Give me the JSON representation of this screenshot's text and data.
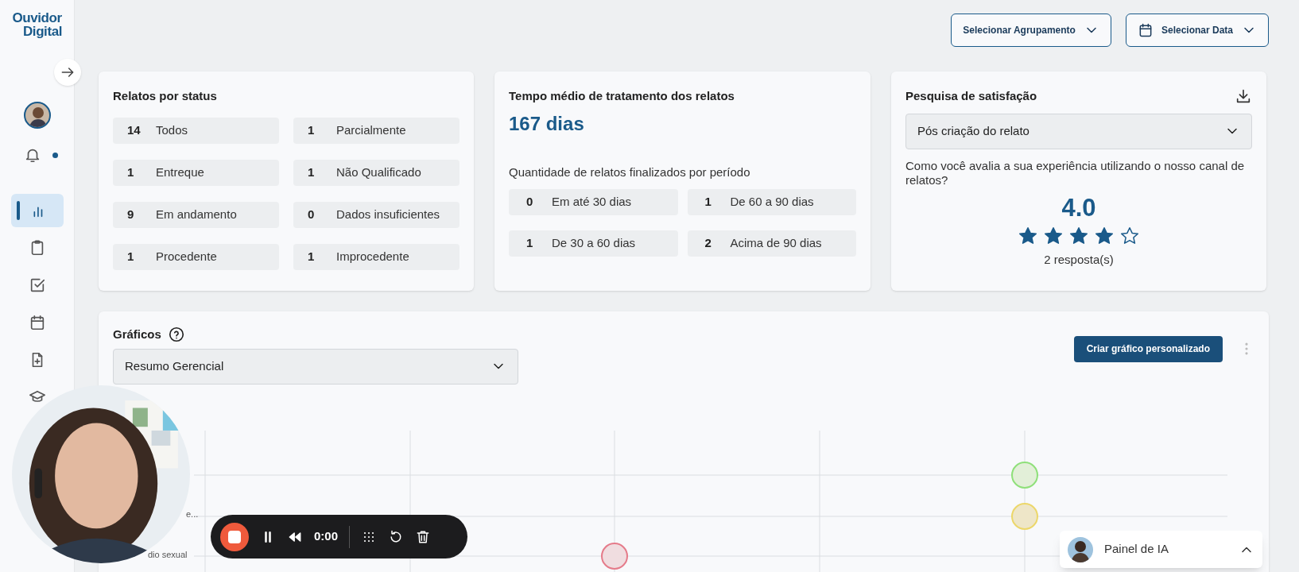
{
  "sidebar": {
    "logo": [
      "Ouvidor",
      "Digital"
    ],
    "notifications_unread": true,
    "items": [
      {
        "kind": "chart",
        "selected": true
      },
      {
        "kind": "clipboard",
        "selected": false
      },
      {
        "kind": "checkbox",
        "selected": false
      },
      {
        "kind": "calendar",
        "selected": false
      },
      {
        "kind": "file-plus",
        "selected": false
      },
      {
        "kind": "graduation",
        "selected": false
      }
    ]
  },
  "toolbar": {
    "buttons": [
      "Selecionar Agrupamento",
      "Selecionar Data"
    ]
  },
  "status_card": {
    "title": "Relatos por status",
    "items": [
      {
        "count": "14",
        "label": "Todos"
      },
      {
        "count": "1",
        "label": "Parcialmente"
      },
      {
        "count": "1",
        "label": "Entreque"
      },
      {
        "count": "1",
        "label": "Não Qualificado"
      },
      {
        "count": "9",
        "label": "Em andamento"
      },
      {
        "count": "0",
        "label": "Dados insuficientes"
      },
      {
        "count": "1",
        "label": "Procedente"
      },
      {
        "count": "1",
        "label": "Improcedente"
      }
    ]
  },
  "time_card": {
    "title": "Tempo médio de tratamento dos relatos",
    "value": "167 dias",
    "subtitle": "Quantidade de relatos finalizados por período",
    "items": [
      {
        "count": "0",
        "label": "Em até 30 dias"
      },
      {
        "count": "1",
        "label": "De 60 a 90 dias"
      },
      {
        "count": "1",
        "label": "De 30 a 60 dias"
      },
      {
        "count": "2",
        "label": "Acima de 90 dias"
      }
    ]
  },
  "survey_card": {
    "title": "Pesquisa de satisfação",
    "select": "Pós criação do relato",
    "question": "Como você avalia a sua experiência utilizando o nosso canal de relatos?",
    "score": "4.0",
    "stars": 4,
    "responses": "2 resposta(s)"
  },
  "charts_card": {
    "title": "Gráficos",
    "select": "Resumo Gerencial",
    "button": "Criar gráfico personalizado",
    "row_labels": [
      "e...",
      "dio sexual"
    ]
  },
  "recorder": {
    "time": "0:00"
  },
  "ai_panel": {
    "label": "Painel de IA"
  }
}
